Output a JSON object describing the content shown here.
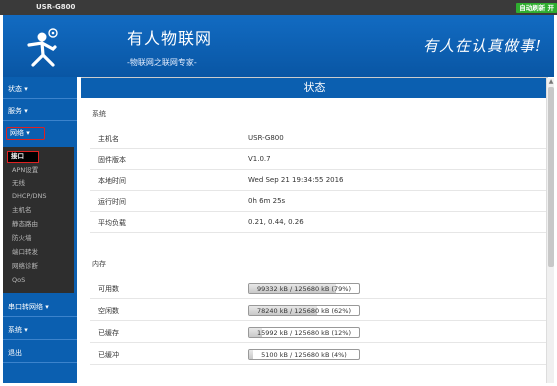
{
  "topbar": {
    "host": "USR-G800",
    "refresh_label": "自动刷新 开"
  },
  "header": {
    "brand": "有人物联网",
    "brand_sub": "-物联网之联网专家-",
    "slogan": "有人在认真做事!"
  },
  "sidebar": {
    "items": [
      {
        "label": "状态 ▾"
      },
      {
        "label": "服务 ▾"
      },
      {
        "label": "网络 ▾"
      },
      {
        "label": "串口转网络 ▾"
      },
      {
        "label": "系统 ▾"
      },
      {
        "label": "退出"
      }
    ],
    "submenu": [
      "接口",
      "APN设置",
      "无线",
      "DHCP/DNS",
      "主机名",
      "静态路由",
      "防火墙",
      "端口转发",
      "网络诊断",
      "QoS"
    ]
  },
  "content": {
    "title": "状态",
    "system_section": "系统",
    "system_rows": [
      {
        "label": "主机名",
        "value": "USR-G800"
      },
      {
        "label": "固件版本",
        "value": "V1.0.7"
      },
      {
        "label": "本地时间",
        "value": "Wed Sep 21 19:34:55 2016"
      },
      {
        "label": "运行时间",
        "value": "0h 6m 25s"
      },
      {
        "label": "平均负载",
        "value": "0.21, 0.44, 0.26"
      }
    ],
    "memory_section": "内存",
    "memory_rows": [
      {
        "label": "可用数",
        "text": "99332 kB / 125680 kB (79%)",
        "percent": 79
      },
      {
        "label": "空闲数",
        "text": "78240 kB / 125680 kB (62%)",
        "percent": 62
      },
      {
        "label": "已缓存",
        "text": "15992 kB / 125680 kB (12%)",
        "percent": 12
      },
      {
        "label": "已缓冲",
        "text": "5100 kB / 125680 kB (4%)",
        "percent": 4
      }
    ]
  },
  "colors": {
    "accent": "#0b5fb0",
    "highlight_border": "#e02020",
    "refresh_bg": "#2fae2f"
  }
}
